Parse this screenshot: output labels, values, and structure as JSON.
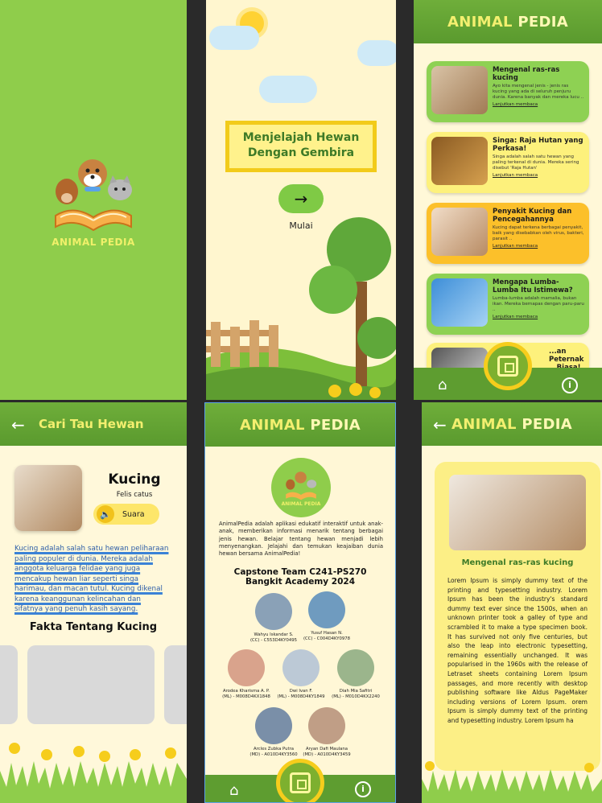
{
  "splash": {
    "brand_animal": "ANIMAL",
    "brand_pedia": "PEDIA"
  },
  "onboarding": {
    "headline_1": "Menjelajah Hewan",
    "headline_2": "Dengan Gembira",
    "start_label": "Mulai",
    "arrow": "→"
  },
  "home": {
    "brand_animal": "ANIMAL",
    "brand_pedia": "PEDIA",
    "articles": [
      {
        "title": "Mengenal ras-ras kucing",
        "desc": "Ayo kita mengenal jenis - jenis ras kucing yang ada di seluruh penjuru dunia. Karena banyak dan mereka lucu ..",
        "more": "Lanjutkan membaca"
      },
      {
        "title": "Singa: Raja Hutan yang Perkasa!",
        "desc": "Singa adalah salah satu hewan yang paling terkenal di dunia. Mereka sering disebut 'Raja Hutan'",
        "more": "Lanjutkan membaca"
      },
      {
        "title": "Penyakit Kucing dan Pencegahannya",
        "desc": "Kucing dapat terkena berbagai penyakit, baik yang disebabkan oleh virus, bakteri, parasit ..",
        "more": "Lanjutkan membaca"
      },
      {
        "title": "Mengapa Lumba-Lumba Itu Istimewa?",
        "desc": "Lumba-lumba adalah mamalia, bukan ikan. Mereka bernapas dengan paru-paru ..",
        "more": "Lanjutkan membaca"
      },
      {
        "title": "...an Peternakan ...Biasa!",
        "desc": "",
        "more": ""
      }
    ]
  },
  "detail": {
    "header": "Cari Tau Hewan",
    "name": "Kucing",
    "latin": "Felis catus",
    "sound_label": "Suara",
    "description": "Kucing adalah salah satu hewan peliharaan paling populer di dunia. Mereka adalah anggota keluarga felidae yang juga mencakup hewan liar seperti singa harimau, dan macan tutul. Kucing dikenal karena keanggunan kelincahan dan sifatnya yang penuh kasih sayang.",
    "facts_title": "Fakta Tentang Kucing"
  },
  "about": {
    "brand_animal": "ANIMAL",
    "brand_pedia": "PEDIA",
    "paragraph": "AnimalPedia adalah aplikasi edukatif interaktif untuk anak-anak, memberikan informasi menarik tentang berbagai jenis hewan. Belajar tentang hewan menjadi lebih menyenangkan. Jelajahi dan temukan keajaiban dunia hewan bersama AnimalPedia!",
    "team_line1": "Capstone Team  C241-PS270",
    "team_line2": "Bangkit Academy 2024",
    "members": [
      {
        "name": "Wahyu Iskandar S.",
        "id": "(CC) - C553D4KY0495"
      },
      {
        "name": "Yusuf Hasan N.",
        "id": "(CC) - C004D4KY0978"
      },
      {
        "name": "Arodea Kharisma A. P.",
        "id": "(ML) - M008D4KX1848"
      },
      {
        "name": "Dwi Ivan F.",
        "id": "(ML) - M008D4KY1849"
      },
      {
        "name": "Diah Mia Safitri",
        "id": "(ML) - M010D4KX2240"
      },
      {
        "name": "Arcles Zubka Putra",
        "id": "(MD) - A010D4KY3560"
      },
      {
        "name": "Aryan Dafi Maulana",
        "id": "(MD) - A010D4KY3459"
      }
    ]
  },
  "article": {
    "brand_animal": "ANIMAL",
    "brand_pedia": "PEDIA",
    "title": "Mengenal ras-ras kucing",
    "body": "Lorem Ipsum is simply dummy text of the printing and typesetting industry. Lorem Ipsum has been the industry's standard dummy text ever since the 1500s, when an unknown printer took a galley of type and scrambled it to make a type specimen book. It has survived not only five centuries, but also the leap into electronic typesetting, remaining essentially unchanged. It was popularised in the 1960s with the release of Letraset sheets containing Lorem Ipsum passages, and more recently with desktop publishing software like Aldus PageMaker including versions of Lorem Ipsum. orem Ipsum is simply dummy text of the printing and typesetting industry. Lorem Ipsum ha"
  },
  "icons": {
    "back": "←",
    "home": "home-icon",
    "info": "i",
    "speaker": "🔈"
  },
  "colors": {
    "brand_green": "#8fcd4b",
    "header_green": "#5e9d30",
    "accent_yellow": "#f6cd1c",
    "cream": "#fff8d8"
  }
}
